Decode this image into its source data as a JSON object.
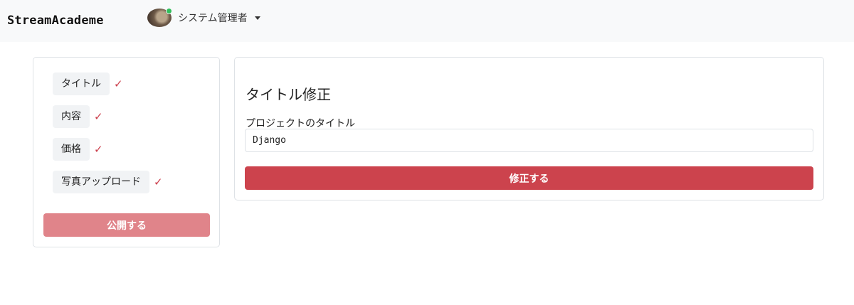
{
  "navbar": {
    "brand": "StreamAcademe",
    "user": {
      "name": "システム管理者",
      "status_color": "#2fbf5a"
    }
  },
  "sidebar": {
    "steps": [
      {
        "label": "タイトル",
        "icon": "check-icon",
        "completed": true
      },
      {
        "label": "内容",
        "icon": "check-icon",
        "completed": true
      },
      {
        "label": "価格",
        "icon": "check-icon",
        "completed": true
      },
      {
        "label": "写真アップロード",
        "icon": "check-icon",
        "completed": true
      }
    ],
    "publish_label": "公開する"
  },
  "main": {
    "heading": "タイトル修正",
    "field_label": "プロジェクトのタイトル",
    "title_value": "Django",
    "submit_label": "修正する"
  },
  "colors": {
    "accent": "#cc434d",
    "accent_disabled": "#e0848a",
    "navbar_bg": "#f8f9fa",
    "check": "#cc3f4c"
  }
}
